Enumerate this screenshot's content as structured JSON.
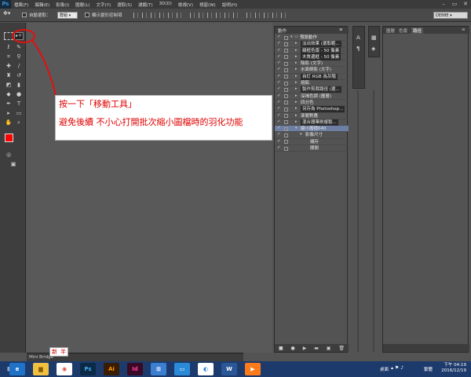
{
  "menubar": {
    "logo": "Ps",
    "items": [
      "檔案(F)",
      "編輯(E)",
      "影像(I)",
      "圖層(L)",
      "文字(Y)",
      "選取(S)",
      "濾鏡(T)",
      "3D(D)",
      "檢視(V)",
      "視窗(W)",
      "說明(H)"
    ],
    "controls": [
      "–",
      "▭",
      "✕"
    ]
  },
  "options": {
    "auto_select_label": "自動選取：",
    "auto_select_value": "群組",
    "show_transform_label": "顯示變形控制項",
    "workspace": "DE88E"
  },
  "callout": {
    "line1": "按一下「移動工具」",
    "line2": "避免後續 不小心打開批次縮小圖檔時的羽化功能"
  },
  "annotation_color": "#e01010",
  "actions": {
    "tab": "動作",
    "items": [
      {
        "label": "預設動作",
        "depth": 0,
        "open": true,
        "style": "light"
      },
      {
        "label": "淡出效果 (選取範...",
        "depth": 1,
        "style": "dark"
      },
      {
        "label": "線框色版 - 50 像素",
        "depth": 1,
        "style": "dark"
      },
      {
        "label": "木質邊框 - 50 像素",
        "depth": 1,
        "style": "dark"
      },
      {
        "label": "陰影 (文字)",
        "depth": 1,
        "style": "light"
      },
      {
        "label": "水面倒影 (文字)",
        "depth": 1,
        "style": "light"
      },
      {
        "label": "自訂 RGB 為灰階",
        "depth": 1,
        "style": "dark"
      },
      {
        "label": "熔鉛",
        "depth": 1,
        "style": "light"
      },
      {
        "label": "製作剪裁路徑 (選...",
        "depth": 1,
        "style": "dark"
      },
      {
        "label": "深褐色調 (圖層)",
        "depth": 1,
        "style": "light"
      },
      {
        "label": "四分色",
        "depth": 1,
        "style": "light"
      },
      {
        "label": "另存為 Photoshop...",
        "depth": 1,
        "style": "dark"
      },
      {
        "label": "漸層對應",
        "depth": 1,
        "style": "light"
      },
      {
        "label": "混合器筆刷複製...",
        "depth": 1,
        "style": "dark"
      },
      {
        "label": "縮小圖檔640",
        "depth": 1,
        "style": "selected"
      },
      {
        "label": "影像尺寸",
        "depth": 2,
        "style": "light"
      },
      {
        "label": "儲存",
        "depth": 3,
        "style": "light"
      },
      {
        "label": "關閉",
        "depth": 3,
        "style": "light"
      }
    ],
    "footer_icons": [
      "■",
      "●",
      "▶",
      "▬",
      "▣",
      "🗑"
    ]
  },
  "layers": {
    "tabs": [
      "圖層",
      "色版",
      "路徑"
    ]
  },
  "bottom": {
    "mini_bridge": "Mini Bridge",
    "ime": [
      "新",
      "半"
    ]
  },
  "taskbar": {
    "apps": [
      {
        "name": "ie",
        "glyph": "e",
        "bg": "#1e73c8",
        "fg": "#ffffff"
      },
      {
        "name": "explorer",
        "glyph": "▆",
        "bg": "#f0c040",
        "fg": "#8a5a00"
      },
      {
        "name": "chrome",
        "glyph": "◉",
        "bg": "#ffffff",
        "fg": "#dd4b39"
      },
      {
        "name": "photoshop",
        "glyph": "Ps",
        "bg": "#0b2a45",
        "fg": "#48a8f0"
      },
      {
        "name": "illustrator",
        "glyph": "Ai",
        "bg": "#3a1c00",
        "fg": "#ff9a00"
      },
      {
        "name": "indesign",
        "glyph": "Id",
        "bg": "#3a0a25",
        "fg": "#ff3fa0"
      },
      {
        "name": "control",
        "glyph": "⊞",
        "bg": "#3a7fd0",
        "fg": "#ffffff"
      },
      {
        "name": "screen",
        "glyph": "▭",
        "bg": "#2b8ad8",
        "fg": "#ffffff"
      },
      {
        "name": "media",
        "glyph": "◐",
        "bg": "#ffffff",
        "fg": "#2a7fd4"
      },
      {
        "name": "word",
        "glyph": "W",
        "bg": "#2b5797",
        "fg": "#ffffff"
      },
      {
        "name": "player",
        "glyph": "▶",
        "bg": "#ff7a1a",
        "fg": "#ffffff"
      }
    ],
    "desktop": "桌面",
    "ime": "繁體",
    "time": "下午 04:19",
    "date": "2016/12/19"
  }
}
